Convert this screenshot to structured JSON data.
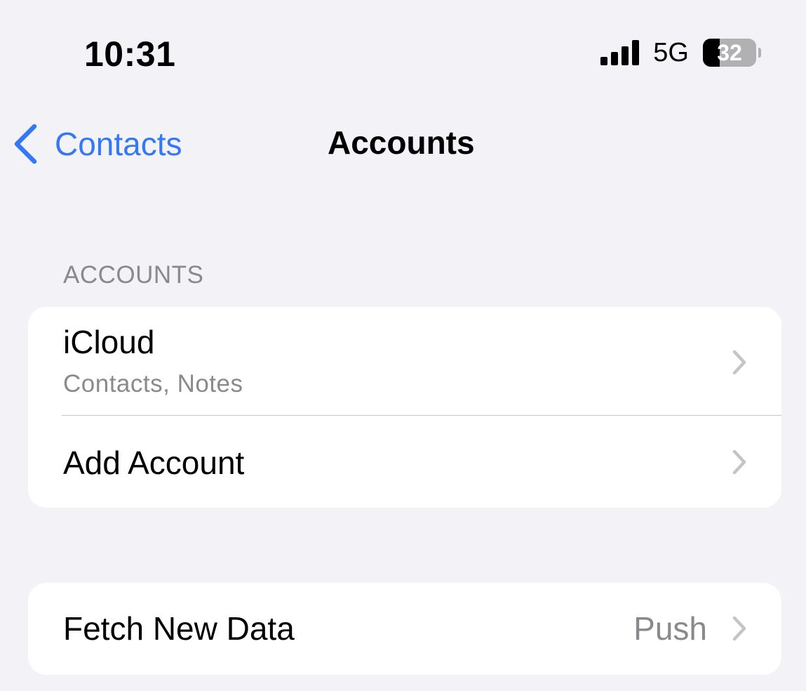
{
  "status_bar": {
    "time": "10:31",
    "network": "5G",
    "battery_level": "32",
    "battery_fraction": 0.32,
    "signal_bars": 4,
    "signal_icon": "cellular-signal-icon",
    "battery_icon": "battery-icon"
  },
  "nav": {
    "back_label": "Contacts",
    "back_icon": "chevron-left-icon",
    "title": "Accounts"
  },
  "accounts_section": {
    "header": "ACCOUNTS",
    "rows": [
      {
        "title": "iCloud",
        "subtitle": "Contacts, Notes",
        "icon": "chevron-right-icon"
      },
      {
        "title": "Add Account",
        "icon": "chevron-right-icon"
      }
    ]
  },
  "fetch_section": {
    "rows": [
      {
        "title": "Fetch New Data",
        "value": "Push",
        "icon": "chevron-right-icon"
      }
    ]
  },
  "colors": {
    "background": "#f2f2f7",
    "accent": "#3478f6",
    "secondary_text": "#8a8a8e",
    "chevron": "#c4c4c7",
    "separator": "#c6c6c8"
  }
}
